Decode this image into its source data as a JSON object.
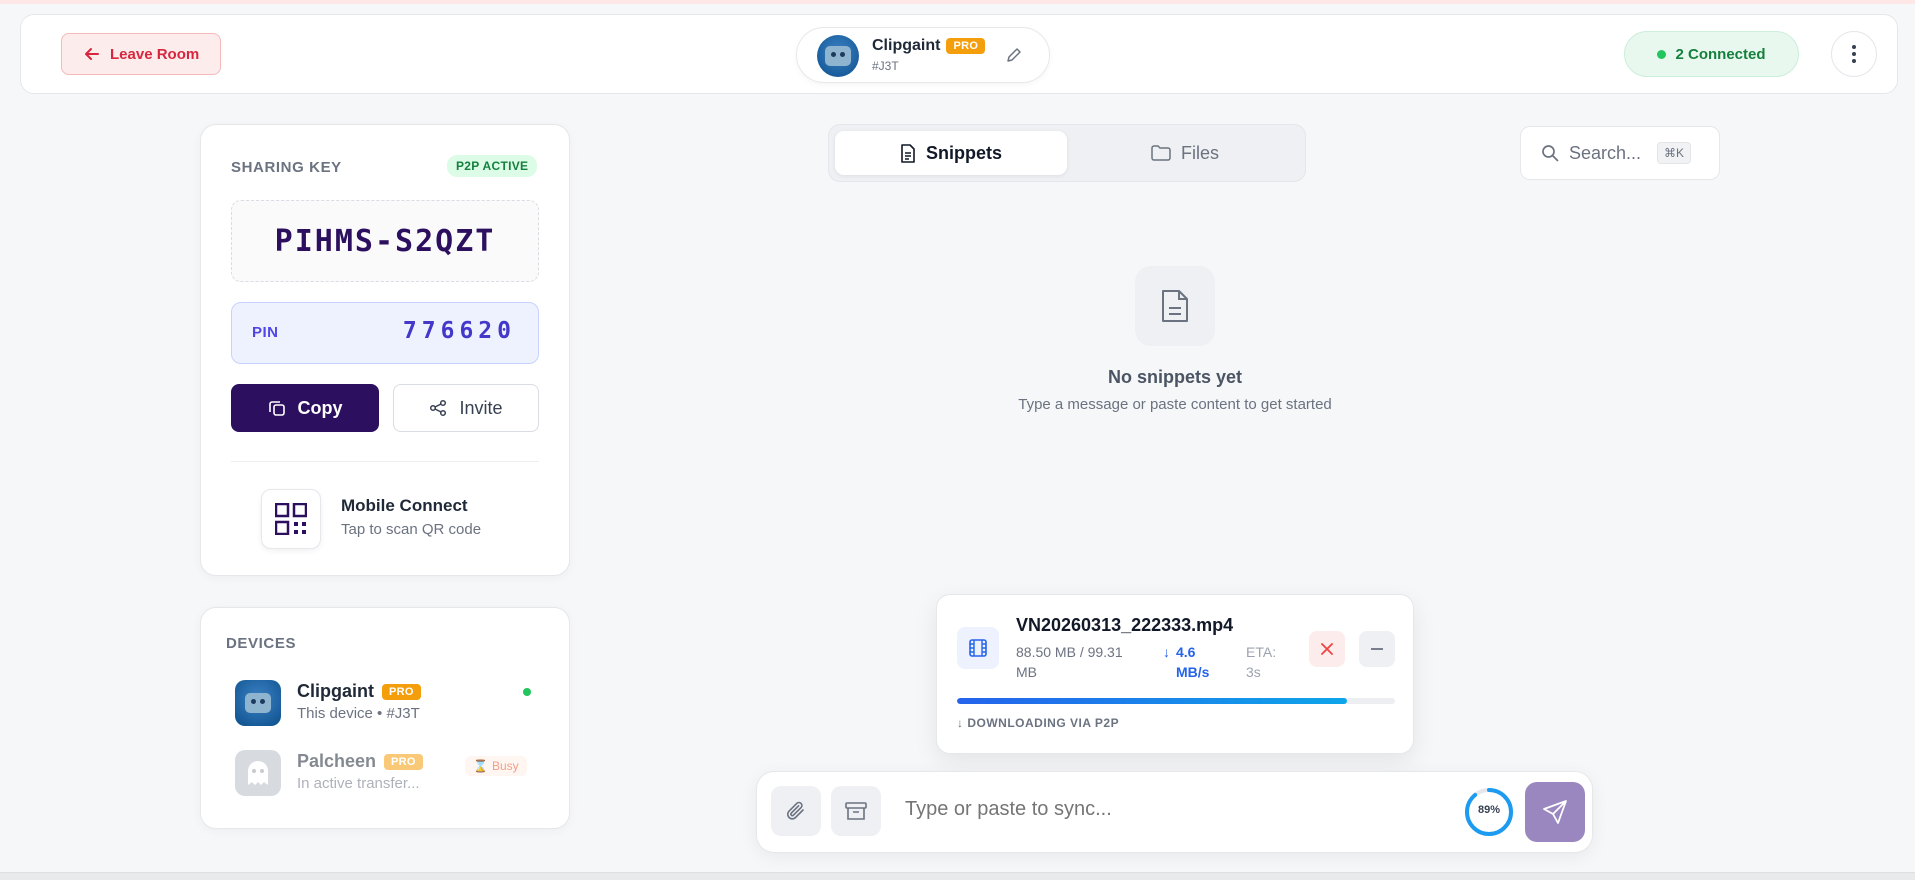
{
  "header": {
    "leave_label": "Leave Room",
    "room_name": "Clipgaint",
    "room_badge": "PRO",
    "room_code": "#J3T",
    "connected_label": "2 Connected"
  },
  "sharing": {
    "title": "SHARING KEY",
    "status_badge": "P2P ACTIVE",
    "key": "PIHMS-S2QZT",
    "pin_label": "PIN",
    "pin_value": "776620",
    "copy_label": "Copy",
    "invite_label": "Invite",
    "mobile_title": "Mobile Connect",
    "mobile_sub": "Tap to scan QR code"
  },
  "devices": {
    "title": "DEVICES",
    "items": [
      {
        "name": "Clipgaint",
        "badge": "PRO",
        "sub": "This device • #J3T",
        "status": "online"
      },
      {
        "name": "Palcheen",
        "badge": "PRO",
        "sub": "In active transfer...",
        "status": "Busy"
      }
    ]
  },
  "tabs": [
    {
      "label": "Snippets",
      "active": true
    },
    {
      "label": "Files",
      "active": false
    }
  ],
  "search": {
    "placeholder": "Search...",
    "shortcut": "⌘K"
  },
  "empty": {
    "title": "No snippets yet",
    "subtitle": "Type a message or paste content to get started"
  },
  "transfer": {
    "file_name": "VN20260313_222333.mp4",
    "size": "88.50 MB / 99.31 MB",
    "speed": "4.6 MB/s",
    "eta": "ETA: 3s",
    "progress": 0.891,
    "via": "DOWNLOADING VIA P2P"
  },
  "composer": {
    "placeholder": "Type or paste to sync...",
    "ring_label": "89%",
    "ring_value": 0.89
  },
  "colors": {
    "accent": "#2d0f5f",
    "danger": "#d7263d",
    "success": "#15803d",
    "pro": "#f59e0b",
    "progress": "#2563eb"
  }
}
